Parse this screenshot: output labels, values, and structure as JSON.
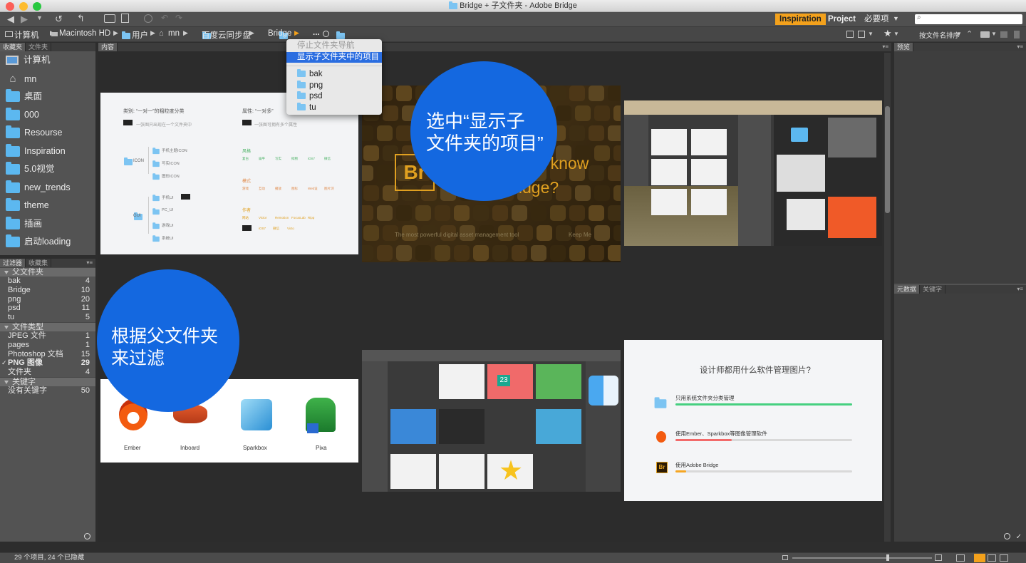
{
  "window": {
    "title": "Bridge + 子文件夹 - Adobe Bridge"
  },
  "workspaces": [
    "Inspiration",
    "Project",
    "必要项"
  ],
  "search": {
    "placeholder": ""
  },
  "path": [
    "计算机",
    "Macintosh HD",
    "用户",
    "mn",
    "百度云同步盘",
    "Bridge",
    "..."
  ],
  "dropdown": {
    "items": [
      "停止文件夹导航",
      "显示子文件夹中的项目"
    ],
    "folders": [
      "bak",
      "png",
      "psd",
      "tu"
    ]
  },
  "left_panel": {
    "tabs": [
      "收藏夹",
      "文件夹"
    ],
    "favorites": [
      "计算机",
      "mn",
      "桌面",
      "000",
      "Resourse",
      "Inspiration",
      "5.0视觉",
      "new_trends",
      "theme",
      "插画",
      "启动loading"
    ]
  },
  "filter_panel": {
    "tabs": [
      "过滤器",
      "收藏集"
    ],
    "sections": [
      {
        "title": "父文件夹",
        "rows": [
          [
            "bak",
            "4"
          ],
          [
            "Bridge",
            "10"
          ],
          [
            "png",
            "20"
          ],
          [
            "psd",
            "11"
          ],
          [
            "tu",
            "5"
          ]
        ]
      },
      {
        "title": "文件类型",
        "rows": [
          [
            "JPEG 文件",
            "1"
          ],
          [
            "pages",
            "1"
          ],
          [
            "Photoshop 文档",
            "15"
          ],
          [
            "PNG 图像",
            "29"
          ],
          [
            "文件夹",
            "4"
          ]
        ]
      },
      {
        "title": "关键字",
        "rows": [
          [
            "没有关键字",
            "50"
          ]
        ]
      }
    ]
  },
  "content": {
    "tab": "内容",
    "sort_label": "按文件名排序",
    "bubble1": [
      "选中“显示子",
      "文件夹的项目”"
    ],
    "bubble2": [
      "根据父文件夹",
      "来过滤"
    ],
    "bridge_splash": {
      "logo": "Br",
      "tagline": [
        "Do you really know",
        "Adobe Bridge?"
      ],
      "footer": "The most powerful digital asset management tool",
      "footer_right": "Keep Me"
    },
    "mindmap": {
      "left_title": "类别: “一对一”的粗粒度分类",
      "left_note": "一张图只出现在一个文件夹中",
      "right_title": "属性: “一对多”",
      "right_note": "一张图可拥有多个属性",
      "nodes": [
        "ICON",
        "GUI"
      ],
      "leaves": [
        "手机主题ICON",
        "写实ICON",
        "图形ICON",
        "手机UI",
        "PC_UI",
        "游戏UI",
        "系统UI"
      ],
      "groups": [
        "风格",
        "模式",
        "作者"
      ],
      "style_tags": [
        "复古",
        "扁平",
        "写实",
        "拟物",
        "iOS7",
        "微信"
      ],
      "mode_tags": [
        "游戏",
        "互动",
        "播放",
        "图标",
        "Web设",
        "图片浏"
      ],
      "author_tags": [
        "网站",
        "Victor",
        "Remotion",
        "FocusLab",
        "Ripp"
      ],
      "extra_tags": [
        "iOS7",
        "微信",
        "Victo"
      ]
    },
    "apps": [
      "Ember",
      "Inboard",
      "Sparkbox",
      "Pixa"
    ],
    "survey": {
      "title": "设计师都用什么软件管理图片?",
      "options": [
        {
          "label": "只用系统文件夹分类管理",
          "value": 100,
          "color": "#46d080"
        },
        {
          "label": "使用Ember、Sparkbox等图像管理软件",
          "value": 32,
          "color": "#f26a6a"
        },
        {
          "label": "使用Adobe Bridge",
          "value": 6,
          "color": "#f5a623"
        }
      ]
    },
    "calendar_tile": "23"
  },
  "right_panel": {
    "preview_tab": "预览",
    "tabs": [
      "元数据",
      "关键字"
    ]
  },
  "status": {
    "text": "29 个项目, 24 个已隐藏"
  }
}
